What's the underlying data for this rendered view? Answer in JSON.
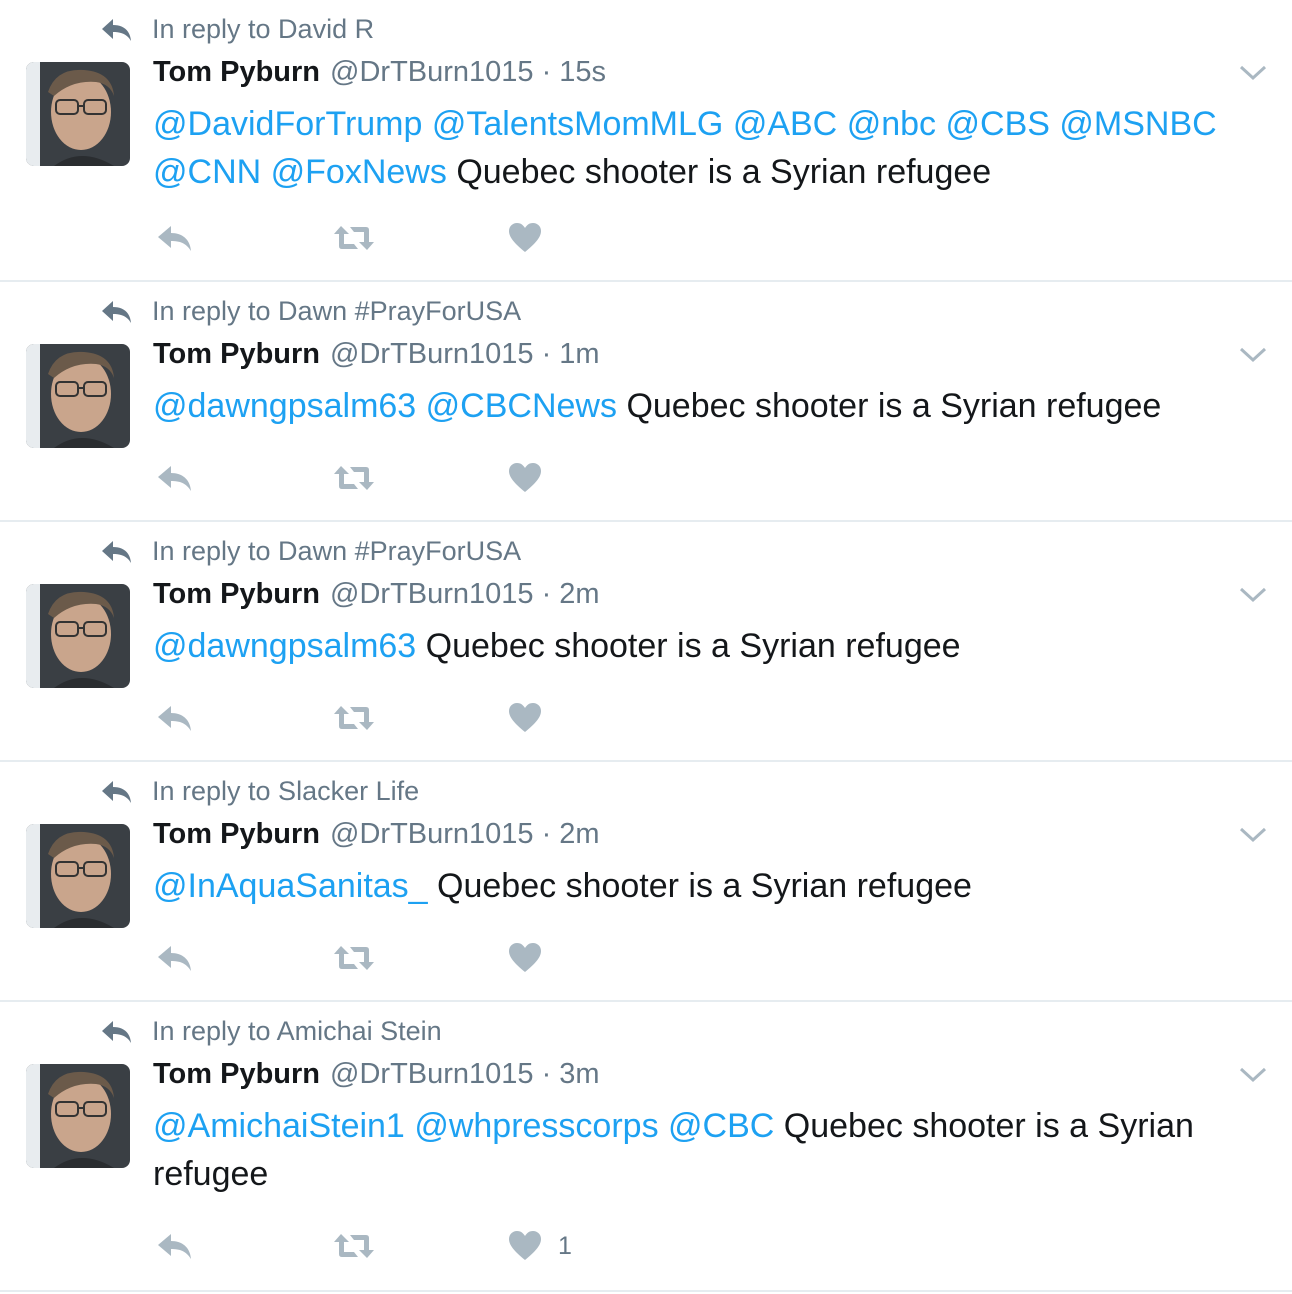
{
  "colors": {
    "link": "#1da1f2",
    "muted": "#657786",
    "action": "#aab8c2",
    "divider": "#e6ecf0"
  },
  "tweets": [
    {
      "context": "In reply to David R",
      "name": "Tom Pyburn",
      "handle": "@DrTBurn1015",
      "dot": "·",
      "time": "15s",
      "mentions": [
        "@DavidForTrump",
        "@TalentsMomMLG",
        "@ABC",
        "@nbc",
        "@CBS",
        "@MSNBC",
        "@CNN",
        "@FoxNews"
      ],
      "body": "Quebec shooter is a Syrian refugee",
      "likes": ""
    },
    {
      "context": "In reply to Dawn #PrayForUSA",
      "name": "Tom Pyburn",
      "handle": "@DrTBurn1015",
      "dot": "·",
      "time": "1m",
      "mentions": [
        "@dawngpsalm63",
        "@CBCNews"
      ],
      "body": "Quebec shooter is a Syrian refugee",
      "likes": ""
    },
    {
      "context": "In reply to Dawn #PrayForUSA",
      "name": "Tom Pyburn",
      "handle": "@DrTBurn1015",
      "dot": "·",
      "time": "2m",
      "mentions": [
        "@dawngpsalm63"
      ],
      "body": "Quebec shooter is a Syrian refugee",
      "likes": ""
    },
    {
      "context": "In reply to Slacker Life",
      "name": "Tom Pyburn",
      "handle": "@DrTBurn1015",
      "dot": "·",
      "time": "2m",
      "mentions": [
        "@InAquaSanitas_"
      ],
      "body": "Quebec shooter is a Syrian refugee",
      "likes": ""
    },
    {
      "context": "In reply to Amichai Stein",
      "name": "Tom Pyburn",
      "handle": "@DrTBurn1015",
      "dot": "·",
      "time": "3m",
      "mentions": [
        "@AmichaiStein1",
        "@whpresscorps",
        "@CBC"
      ],
      "body": "Quebec shooter is a Syrian refugee",
      "likes": "1"
    }
  ]
}
